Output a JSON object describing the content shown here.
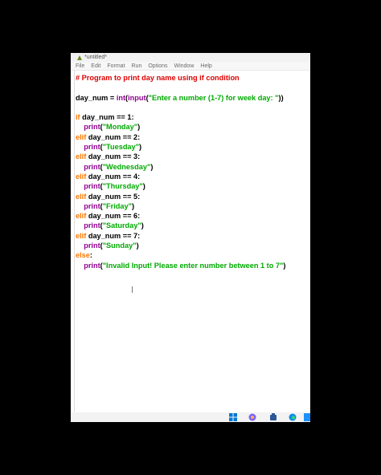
{
  "window": {
    "title": "*untitled*",
    "menu": [
      "File",
      "Edit",
      "Format",
      "Run",
      "Options",
      "Window",
      "Help"
    ]
  },
  "code_lines": [
    [
      {
        "t": "# Program to print day name using if condition",
        "c": "c"
      }
    ],
    [],
    [
      {
        "t": "day_num = ",
        "c": ""
      },
      {
        "t": "int",
        "c": "b"
      },
      {
        "t": "(",
        "c": ""
      },
      {
        "t": "input",
        "c": "b"
      },
      {
        "t": "(",
        "c": ""
      },
      {
        "t": "\"Enter a number (1-7) for week day: \"",
        "c": "s"
      },
      {
        "t": "))",
        "c": ""
      }
    ],
    [],
    [
      {
        "t": "if",
        "c": "k"
      },
      {
        "t": " day_num == 1:",
        "c": ""
      }
    ],
    [
      {
        "t": "    ",
        "c": ""
      },
      {
        "t": "print",
        "c": "b"
      },
      {
        "t": "(",
        "c": ""
      },
      {
        "t": "\"Monday\"",
        "c": "s"
      },
      {
        "t": ")",
        "c": ""
      }
    ],
    [
      {
        "t": "elif",
        "c": "k"
      },
      {
        "t": " day_num == 2:",
        "c": ""
      }
    ],
    [
      {
        "t": "    ",
        "c": ""
      },
      {
        "t": "print",
        "c": "b"
      },
      {
        "t": "(",
        "c": ""
      },
      {
        "t": "\"Tuesday\"",
        "c": "s"
      },
      {
        "t": ")",
        "c": ""
      }
    ],
    [
      {
        "t": "elif",
        "c": "k"
      },
      {
        "t": " day_num == 3:",
        "c": ""
      }
    ],
    [
      {
        "t": "    ",
        "c": ""
      },
      {
        "t": "print",
        "c": "b"
      },
      {
        "t": "(",
        "c": ""
      },
      {
        "t": "\"Wednesday\"",
        "c": "s"
      },
      {
        "t": ")",
        "c": ""
      }
    ],
    [
      {
        "t": "elif",
        "c": "k"
      },
      {
        "t": " day_num == 4:",
        "c": ""
      }
    ],
    [
      {
        "t": "    ",
        "c": ""
      },
      {
        "t": "print",
        "c": "b"
      },
      {
        "t": "(",
        "c": ""
      },
      {
        "t": "\"Thursday\"",
        "c": "s"
      },
      {
        "t": ")",
        "c": ""
      }
    ],
    [
      {
        "t": "elif",
        "c": "k"
      },
      {
        "t": " day_num == 5:",
        "c": ""
      }
    ],
    [
      {
        "t": "    ",
        "c": ""
      },
      {
        "t": "print",
        "c": "b"
      },
      {
        "t": "(",
        "c": ""
      },
      {
        "t": "\"Friday\"",
        "c": "s"
      },
      {
        "t": ")",
        "c": ""
      }
    ],
    [
      {
        "t": "elif",
        "c": "k"
      },
      {
        "t": " day_num == 6:",
        "c": ""
      }
    ],
    [
      {
        "t": "    ",
        "c": ""
      },
      {
        "t": "print",
        "c": "b"
      },
      {
        "t": "(",
        "c": ""
      },
      {
        "t": "\"Saturday\"",
        "c": "s"
      },
      {
        "t": ")",
        "c": ""
      }
    ],
    [
      {
        "t": "elif",
        "c": "k"
      },
      {
        "t": " day_num == 7:",
        "c": ""
      }
    ],
    [
      {
        "t": "    ",
        "c": ""
      },
      {
        "t": "print",
        "c": "b"
      },
      {
        "t": "(",
        "c": ""
      },
      {
        "t": "\"Sunday\"",
        "c": "s"
      },
      {
        "t": ")",
        "c": ""
      }
    ],
    [
      {
        "t": "else",
        "c": "k"
      },
      {
        "t": ":",
        "c": ""
      }
    ],
    [
      {
        "t": "    ",
        "c": ""
      },
      {
        "t": "print",
        "c": "b"
      },
      {
        "t": "(",
        "c": ""
      },
      {
        "t": "\"Invalid Input! Please enter number between 1 to 7\"",
        "c": "s"
      },
      {
        "t": ")",
        "c": ""
      }
    ]
  ],
  "colors": {
    "keyword": "#ff7700",
    "string": "#00aa00",
    "builtin": "#900090",
    "comment": "#dd0000"
  },
  "taskbar_icons": [
    "windows-start-icon",
    "copilot-icon",
    "app-icon",
    "edge-browser-icon",
    "app-icon-2"
  ]
}
